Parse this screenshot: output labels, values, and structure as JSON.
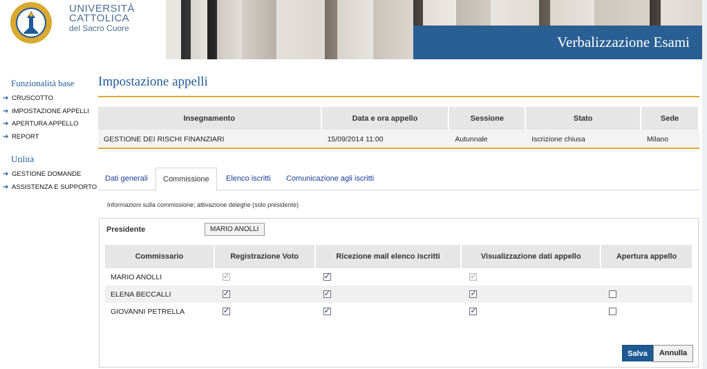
{
  "header": {
    "university_line1": "UNIVERSITÀ",
    "university_line2": "CATTOLICA",
    "university_line3": "del Sacro Cuore",
    "app_title": "Verbalizzazione Esami",
    "seal_text": "UNIVERSITÀ CATTOLICA DEL SACRO CUORE MEDIOLANI"
  },
  "sidebar": {
    "section1": "Funzionalità base",
    "items1": [
      "CRUSCOTTO",
      "IMPOSTAZIONE APPELLI",
      "APERTURA APPELLO",
      "REPORT"
    ],
    "section2": "Utilità",
    "items2": [
      "GESTIONE DOMANDE",
      "ASSISTENZA E SUPPORTO"
    ]
  },
  "main": {
    "title": "Impostazione appelli",
    "info_table": {
      "headers": [
        "Insegnamento",
        "Data e ora appello",
        "Sessione",
        "Stato",
        "Sede"
      ],
      "row": [
        "GESTIONE DEI RISCHI FINANZIARI",
        "15/09/2014 11:00",
        "Autunnale",
        "Iscrizione chiusa",
        "Milano"
      ]
    },
    "tabs": [
      "Dati generali",
      "Commissione",
      "Elenco iscritti",
      "Comunicazione agli iscritti"
    ],
    "active_tab": "Commissione",
    "description": "Informazioni sulla commissione; attivazione deleghe (solo presidente)",
    "president_label": "Presidente",
    "president_value": "MARIO ANOLLI",
    "commission_table": {
      "headers": [
        "Commissario",
        "Registrazione Voto",
        "Ricezione mail elenco iscritti",
        "Visualizzazione dati appello",
        "Apertura appello"
      ],
      "rows": [
        {
          "name": "MARIO ANOLLI",
          "checks": [
            true,
            true,
            true,
            null
          ],
          "disabled": [
            true,
            false,
            true,
            null
          ]
        },
        {
          "name": "ELENA BECCALLI",
          "checks": [
            true,
            true,
            true,
            false
          ],
          "disabled": [
            false,
            false,
            false,
            false
          ]
        },
        {
          "name": "GIOVANNI PETRELLA",
          "checks": [
            true,
            true,
            true,
            false
          ],
          "disabled": [
            false,
            false,
            false,
            false
          ]
        }
      ]
    },
    "save_label": "Salva",
    "cancel_label": "Annulla"
  },
  "colors": {
    "brand_blue": "#2a5f94",
    "link_blue": "#1a3c9a",
    "gold_rule": "#d9a930",
    "save_button": "#1e5b95"
  }
}
